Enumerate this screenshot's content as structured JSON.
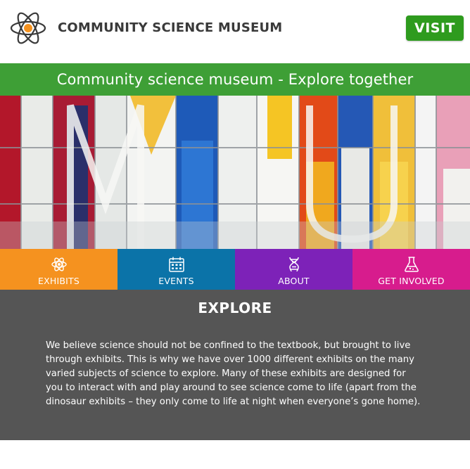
{
  "header": {
    "site_name": "COMMUNITY SCIENCE MUSEUM",
    "visit_label": "VISIT",
    "logo_icon": "atom-icon"
  },
  "hero": {
    "banner_text": "Community science museum - Explore together"
  },
  "nav": {
    "items": [
      {
        "label": "EXHIBITS",
        "icon": "atom-icon",
        "color": "#f5921f"
      },
      {
        "label": "EVENTS",
        "icon": "calendar-icon",
        "color": "#0b73a8"
      },
      {
        "label": "ABOUT",
        "icon": "dna-icon",
        "color": "#7d22b8"
      },
      {
        "label": "GET INVOLVED",
        "icon": "flask-icon",
        "color": "#d71c8d"
      }
    ]
  },
  "explore": {
    "title": "EXPLORE",
    "body": "We believe science should not be confined to the textbook, but brought to live through exhibits. This is why we have over 1000 different exhibits on the many varied subjects of science to explore. Many of these exhibits are designed for you to interact with and play around to see science come to life (apart from the dinosaur exhibits – they only come to life at night when everyone’s gone home)."
  },
  "colors": {
    "brand_green": "#2e9b1e",
    "explore_bg": "#555555"
  }
}
